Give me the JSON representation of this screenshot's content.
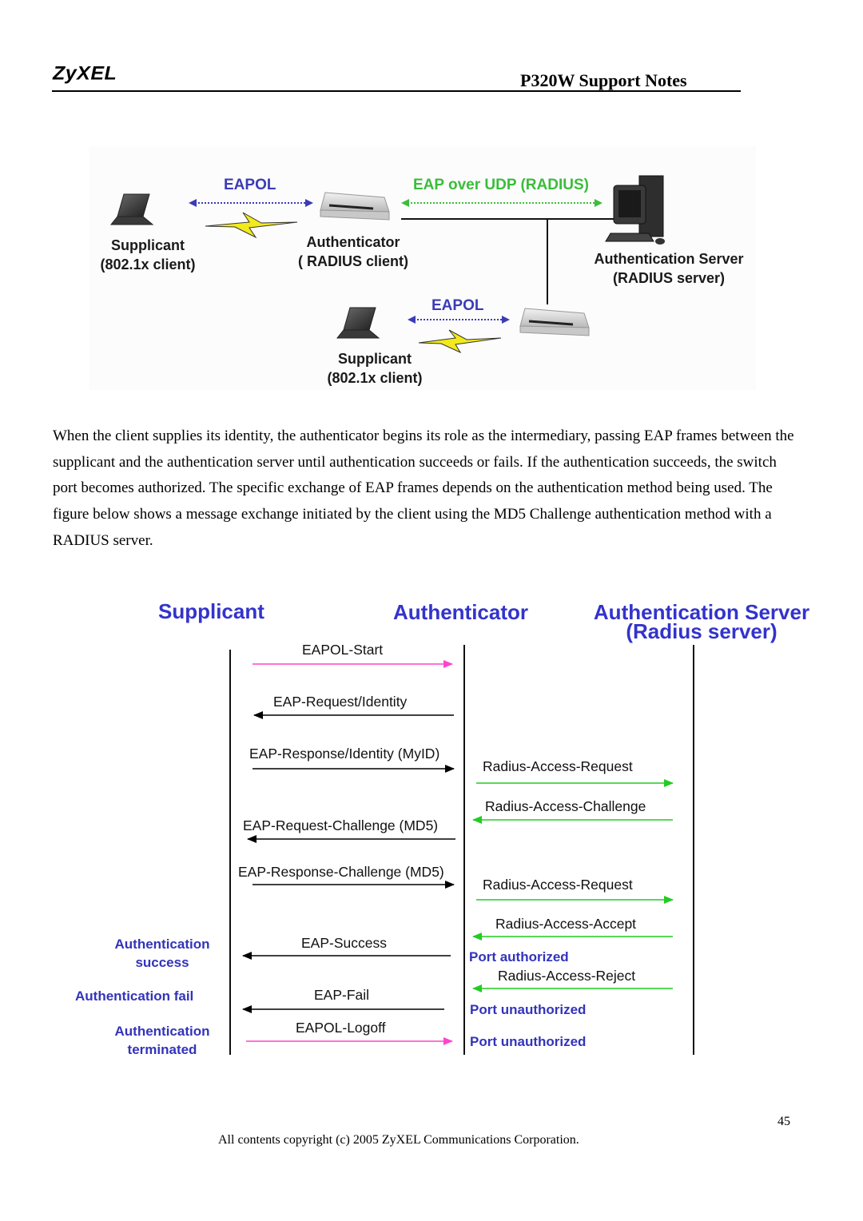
{
  "header": {
    "logo": "ZyXEL",
    "title": "P320W Support Notes"
  },
  "figure1": {
    "nodes": {
      "supplicant_top": {
        "name": "Supplicant",
        "sub": "(802.1x client)",
        "icon": "laptop-icon"
      },
      "authenticator": {
        "name": "Authenticator",
        "sub": "( RADIUS client)",
        "icon": "access-point-icon"
      },
      "server": {
        "name": "Authentication Server",
        "sub": "(RADIUS server)",
        "icon": "desktop-computer-icon"
      },
      "supplicant_bottom": {
        "name": "Supplicant",
        "sub": "(802.1x client)",
        "icon": "laptop-icon"
      },
      "authenticator_bottom": {
        "icon": "access-point-icon"
      }
    },
    "links": {
      "eapol_top": "EAPOL",
      "eap_udp": "EAP over UDP (RADIUS)",
      "eapol_bottom": "EAPOL"
    },
    "colors": {
      "eapol": "#3b3bb8",
      "radius": "#3bbd3b",
      "wireless": "#f2ea1c"
    }
  },
  "body": {
    "paragraph": "When the client supplies its identity, the authenticator begins its role as the intermediary, passing EAP frames between the supplicant and the authentication server until authentication succeeds or fails. If the authentication succeeds, the switch port becomes authorized. The specific exchange of EAP frames depends on the authentication method being used. The figure below shows a message exchange initiated by the client using the MD5 Challenge authentication method with a RADIUS server."
  },
  "figure2": {
    "columns": {
      "supplicant": "Supplicant",
      "authenticator": "Authenticator",
      "server_line1": "Authentication Server",
      "server_line2": "(Radius server)"
    },
    "messages": [
      {
        "label": "EAPOL-Start",
        "from": "supplicant",
        "to": "authenticator",
        "color": "#ff44cc"
      },
      {
        "label": "EAP-Request/Identity",
        "from": "authenticator",
        "to": "supplicant",
        "color": "#000000"
      },
      {
        "label": "EAP-Response/Identity (MyID)",
        "from": "supplicant",
        "to": "authenticator",
        "color": "#000000"
      },
      {
        "label": "Radius-Access-Request",
        "from": "authenticator",
        "to": "server",
        "color": "#22cc22"
      },
      {
        "label": "Radius-Access-Challenge",
        "from": "server",
        "to": "authenticator",
        "color": "#22cc22"
      },
      {
        "label": "EAP-Request-Challenge (MD5)",
        "from": "authenticator",
        "to": "supplicant",
        "color": "#000000"
      },
      {
        "label": "EAP-Response-Challenge (MD5)",
        "from": "supplicant",
        "to": "authenticator",
        "color": "#000000"
      },
      {
        "label": "Radius-Access-Request",
        "from": "authenticator",
        "to": "server",
        "color": "#22cc22"
      },
      {
        "label": "Radius-Access-Accept",
        "from": "server",
        "to": "authenticator",
        "color": "#22cc22"
      },
      {
        "label": "EAP-Success",
        "from": "authenticator",
        "to": "supplicant",
        "color": "#000000"
      },
      {
        "label": "Radius-Access-Reject",
        "from": "server",
        "to": "authenticator",
        "color": "#22cc22"
      },
      {
        "label": "EAP-Fail",
        "from": "authenticator",
        "to": "supplicant",
        "color": "#000000"
      },
      {
        "label": "EAPOL-Logoff",
        "from": "supplicant",
        "to": "authenticator",
        "color": "#ff44cc"
      }
    ],
    "states": {
      "auth_success_1": "Authentication",
      "auth_success_2": "success",
      "auth_fail": "Authentication fail",
      "auth_term_1": "Authentication",
      "auth_term_2": "terminated",
      "port_authorized": "Port authorized",
      "port_unauthorized_1": "Port unauthorized",
      "port_unauthorized_2": "Port unauthorized"
    },
    "label_color": "#3333bb"
  },
  "footer": {
    "page_number": "45",
    "copyright": "All contents copyright (c) 2005 ZyXEL Communications Corporation."
  }
}
